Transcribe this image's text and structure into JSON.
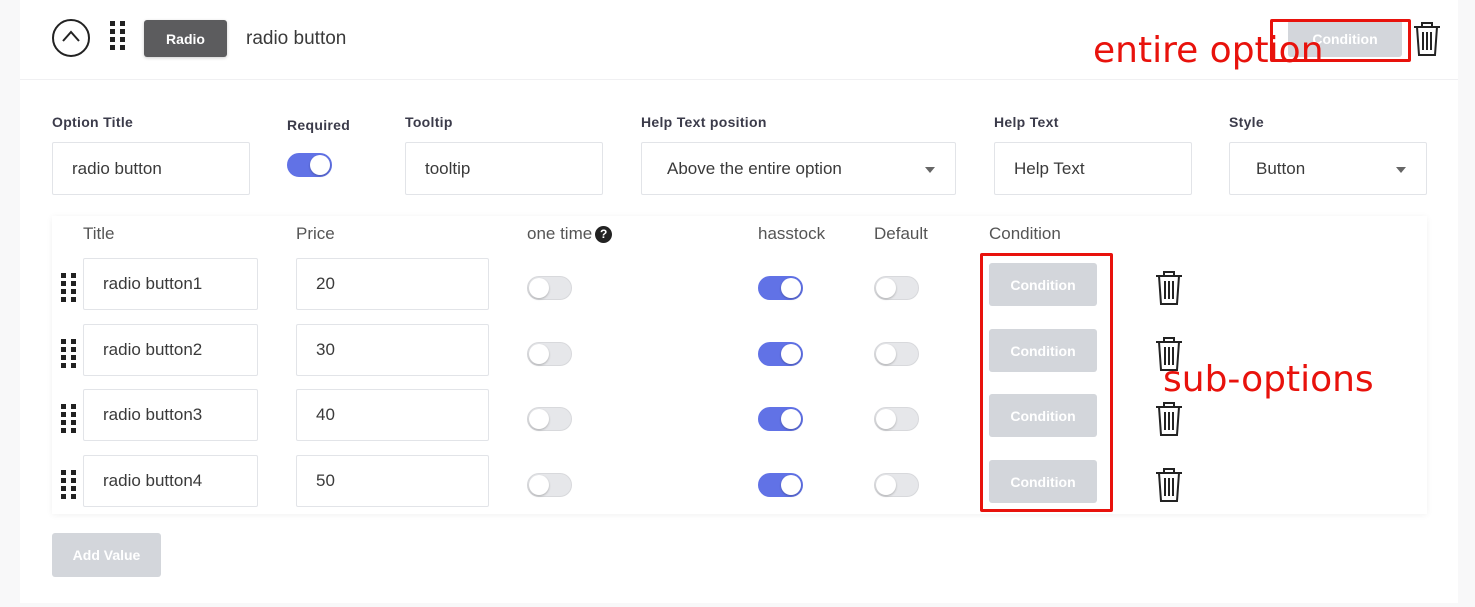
{
  "header": {
    "type_label": "Radio",
    "option_name": "radio button",
    "condition_label": "Condition"
  },
  "fields": {
    "option_title": {
      "label": "Option Title",
      "value": "radio button"
    },
    "required": {
      "label": "Required",
      "on": true
    },
    "tooltip": {
      "label": "Tooltip",
      "value": "tooltip"
    },
    "help_text_position": {
      "label": "Help Text position",
      "value": "Above the entire option"
    },
    "help_text": {
      "label": "Help Text",
      "value": "Help Text"
    },
    "style": {
      "label": "Style",
      "value": "Button"
    }
  },
  "sub_options": {
    "columns": {
      "title": "Title",
      "price": "Price",
      "one_time": "one time",
      "help_mark": "?",
      "hasstock": "hasstock",
      "default": "Default",
      "condition": "Condition"
    },
    "condition_label": "Condition",
    "rows": [
      {
        "title": "radio button1",
        "price": "20",
        "one_time": false,
        "hasstock": true,
        "default": false
      },
      {
        "title": "radio button2",
        "price": "30",
        "one_time": false,
        "hasstock": true,
        "default": false
      },
      {
        "title": "radio button3",
        "price": "40",
        "one_time": false,
        "hasstock": true,
        "default": false
      },
      {
        "title": "radio button4",
        "price": "50",
        "one_time": false,
        "hasstock": true,
        "default": false
      }
    ]
  },
  "add_value_label": "Add Value",
  "annotations": {
    "entire_option": "entire option",
    "sub_options": "sub-options",
    "color": "#e8120c"
  },
  "colors": {
    "toggle_on": "#6172e6",
    "condition_button": "#d3d6db",
    "type_badge": "#5c5c5e"
  }
}
